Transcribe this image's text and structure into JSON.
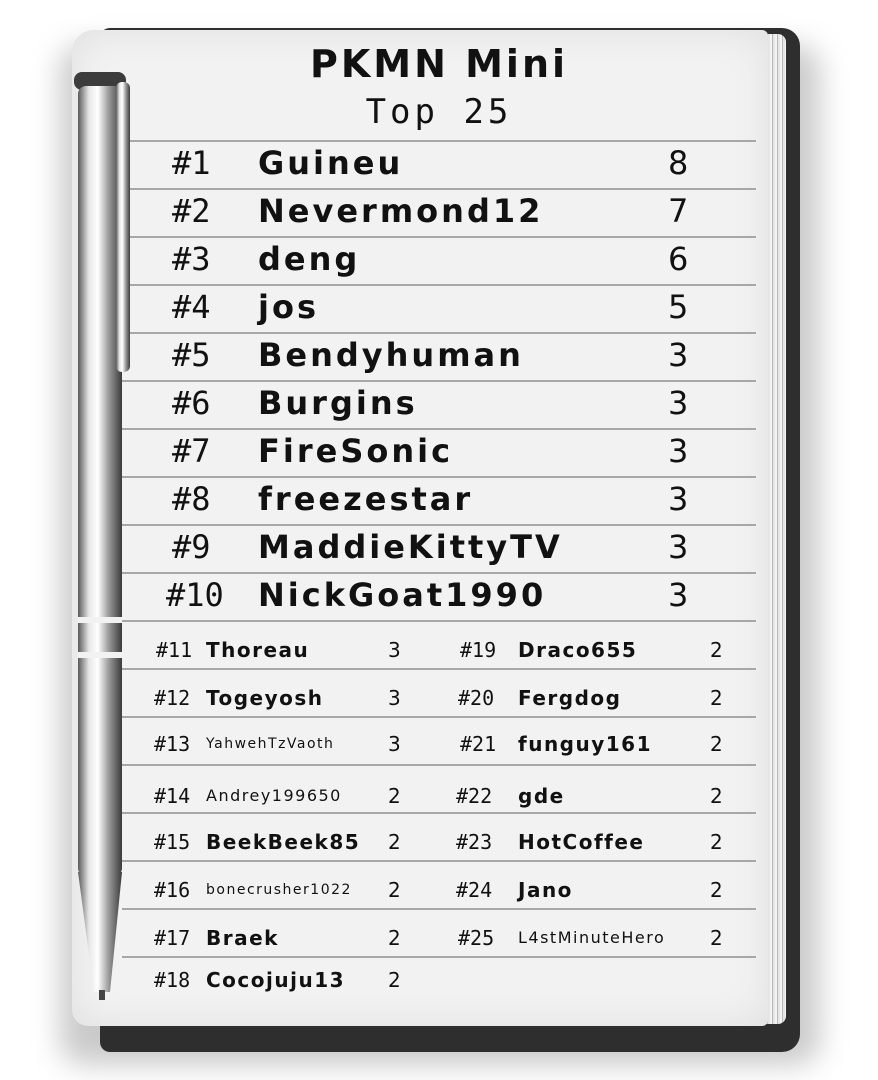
{
  "header": {
    "title": "PKMN Mini",
    "subtitle": "Top 25"
  },
  "top10": [
    {
      "rank": "#1",
      "name": "Guineu",
      "score": "8"
    },
    {
      "rank": "#2",
      "name": "Nevermond12",
      "score": "7"
    },
    {
      "rank": "#3",
      "name": "deng",
      "score": "6"
    },
    {
      "rank": "#4",
      "name": "jos",
      "score": "5"
    },
    {
      "rank": "#5",
      "name": "Bendyhuman",
      "score": "3"
    },
    {
      "rank": "#6",
      "name": "Burgins",
      "score": "3"
    },
    {
      "rank": "#7",
      "name": "FireSonic",
      "score": "3"
    },
    {
      "rank": "#8",
      "name": "freezestar",
      "score": "3"
    },
    {
      "rank": "#9",
      "name": "MaddieKittyTV",
      "score": "3"
    },
    {
      "rank": "#10",
      "name": "NickGoat1990",
      "score": "3"
    }
  ],
  "left": [
    {
      "rank": "#11",
      "name": "Thoreau",
      "score": "3"
    },
    {
      "rank": "#12",
      "name": "Togeyosh",
      "score": "3"
    },
    {
      "rank": "#13",
      "name": "YahwehTzVaoth",
      "score": "3"
    },
    {
      "rank": "#14",
      "name": "Andrey199650",
      "score": "2"
    },
    {
      "rank": "#15",
      "name": "BeekBeek85",
      "score": "2"
    },
    {
      "rank": "#16",
      "name": "bonecrusher1022",
      "score": "2"
    },
    {
      "rank": "#17",
      "name": "Braek",
      "score": "2"
    },
    {
      "rank": "#18",
      "name": "Cocojuju13",
      "score": "2"
    }
  ],
  "right": [
    {
      "rank": "#19",
      "name": "Draco655",
      "score": "2"
    },
    {
      "rank": "#20",
      "name": "Fergdog",
      "score": "2"
    },
    {
      "rank": "#21",
      "name": "funguy161",
      "score": "2"
    },
    {
      "rank": "#22",
      "name": "gde",
      "score": "2"
    },
    {
      "rank": "#23",
      "name": "HotCoffee",
      "score": "2"
    },
    {
      "rank": "#24",
      "name": "Jano",
      "score": "2"
    },
    {
      "rank": "#25",
      "name": "L4stMinuteHero",
      "score": "2"
    }
  ]
}
